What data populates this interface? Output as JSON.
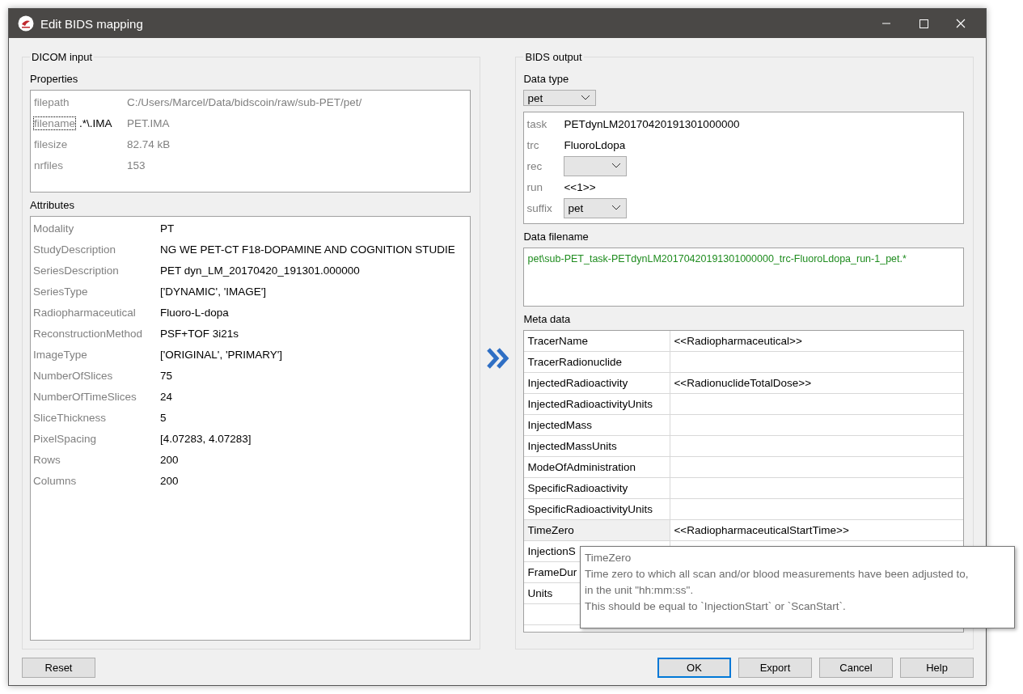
{
  "window": {
    "title": "Edit BIDS mapping"
  },
  "dicom_input": {
    "title": "DICOM input",
    "properties": {
      "label": "Properties",
      "rows": [
        {
          "key": "filepath",
          "focused": false,
          "value": "C:/Users/Marcel/Data/bidscoin/raw/sub-PET/pet/"
        },
        {
          "key": "filename",
          "focused": true,
          "pattern": ".*\\.IMA",
          "value": "PET.IMA"
        },
        {
          "key": "filesize",
          "focused": false,
          "value": "82.74 kB"
        },
        {
          "key": "nrfiles",
          "focused": false,
          "value": "153"
        }
      ]
    },
    "attributes": {
      "label": "Attributes",
      "rows": [
        {
          "key": "Modality",
          "value": "PT"
        },
        {
          "key": "StudyDescription",
          "value": "NG WE PET-CT F18-DOPAMINE AND COGNITION STUDIE"
        },
        {
          "key": "SeriesDescription",
          "value": "PET dyn_LM_20170420_191301.000000"
        },
        {
          "key": "SeriesType",
          "value": "['DYNAMIC', 'IMAGE']"
        },
        {
          "key": "Radiopharmaceutical",
          "value": "Fluoro-L-dopa"
        },
        {
          "key": "ReconstructionMethod",
          "value": "PSF+TOF 3i21s"
        },
        {
          "key": "ImageType",
          "value": "['ORIGINAL', 'PRIMARY']"
        },
        {
          "key": "NumberOfSlices",
          "value": "75"
        },
        {
          "key": "NumberOfTimeSlices",
          "value": "24"
        },
        {
          "key": "SliceThickness",
          "value": "5"
        },
        {
          "key": "PixelSpacing",
          "value": "[4.07283, 4.07283]"
        },
        {
          "key": "Rows",
          "value": "200"
        },
        {
          "key": "Columns",
          "value": "200"
        }
      ]
    }
  },
  "bids_output": {
    "title": "BIDS output",
    "data_type": {
      "label": "Data type",
      "value": "pet"
    },
    "entities": [
      {
        "key": "task",
        "kind": "text",
        "value": "PETdynLM20170420191301000000"
      },
      {
        "key": "trc",
        "kind": "text",
        "value": "FluoroLdopa"
      },
      {
        "key": "rec",
        "kind": "dropdown"
      },
      {
        "key": "run",
        "kind": "text",
        "value": "<<1>>"
      },
      {
        "key": "suffix",
        "kind": "dropdown",
        "value": "pet"
      }
    ],
    "data_filename": {
      "label": "Data filename",
      "value": "pet\\sub-PET_task-PETdynLM20170420191301000000_trc-FluoroLdopa_run-1_pet.*"
    },
    "meta_data": {
      "label": "Meta data",
      "rows": [
        {
          "key": "TracerName",
          "selected": false,
          "value": "<<Radiopharmaceutical>>"
        },
        {
          "key": "TracerRadionuclide",
          "selected": false
        },
        {
          "key": "InjectedRadioactivity",
          "selected": false,
          "value": "<<RadionuclideTotalDose>>"
        },
        {
          "key": "InjectedRadioactivityUnits",
          "selected": false
        },
        {
          "key": "InjectedMass",
          "selected": false
        },
        {
          "key": "InjectedMassUnits",
          "selected": false
        },
        {
          "key": "ModeOfAdministration",
          "selected": false
        },
        {
          "key": "SpecificRadioactivity",
          "selected": false
        },
        {
          "key": "SpecificRadioactivityUnits",
          "selected": false
        },
        {
          "key": "TimeZero",
          "selected": true,
          "value": "<<RadiopharmaceuticalStartTime>>"
        },
        {
          "key": "InjectionS",
          "selected": false
        },
        {
          "key": "FrameDur",
          "selected": false
        },
        {
          "key": "Units",
          "selected": false
        }
      ]
    }
  },
  "tooltip": {
    "title": "TimeZero",
    "lines": [
      "Time zero to which all scan and/or blood measurements have been adjusted to,",
      "in the unit \"hh:mm:ss\".",
      "This should be equal to `InjectionStart` or `ScanStart`."
    ]
  },
  "buttons_left": [
    {
      "label": "Reset",
      "default": false
    }
  ],
  "buttons_right": [
    {
      "label": "OK",
      "default": true
    },
    {
      "label": "Export",
      "default": false
    },
    {
      "label": "Cancel",
      "default": false
    },
    {
      "label": "Help",
      "default": false
    }
  ]
}
